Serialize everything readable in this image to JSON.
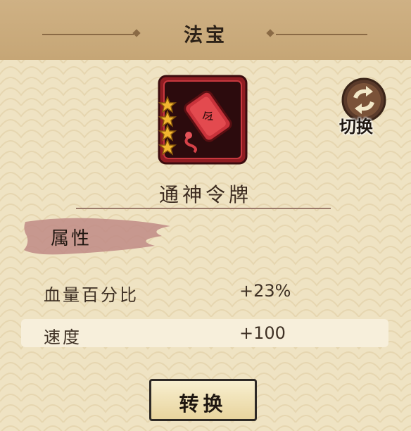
{
  "header": {
    "title": "法宝"
  },
  "item": {
    "name": "通神令牌",
    "stars": 4,
    "icon": "token-plaque-icon"
  },
  "swap": {
    "label": "切换",
    "icon": "swap-arrows-icon"
  },
  "attributes": {
    "tab_label": "属性",
    "rows": [
      {
        "label": "血量百分比",
        "value": "+23%"
      },
      {
        "label": "速度",
        "value": "+100"
      }
    ]
  },
  "convert": {
    "label": "转换"
  },
  "colors": {
    "panel": "#efe3c3",
    "header": "#c9aa7a",
    "accent": "#a8363a",
    "star": "#f2b630"
  }
}
